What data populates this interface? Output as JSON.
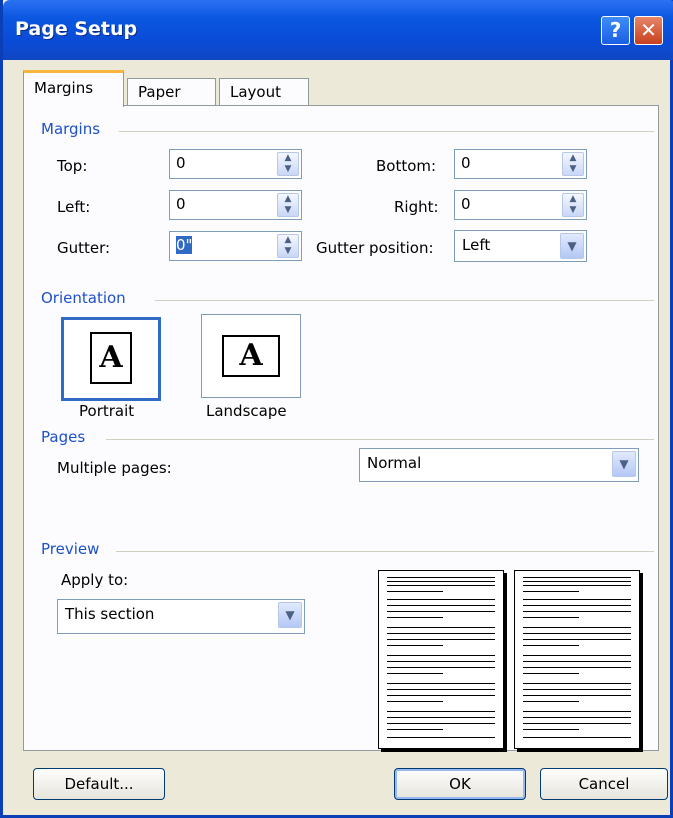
{
  "window": {
    "title": "Page Setup"
  },
  "titlebar": {
    "help_glyph": "?",
    "close_glyph": "✕"
  },
  "tabs": [
    "Margins",
    "Paper",
    "Layout"
  ],
  "margins": {
    "group_label": "Margins",
    "top": {
      "label": "Top:",
      "value": "0"
    },
    "bottom": {
      "label": "Bottom:",
      "value": "0"
    },
    "left": {
      "label": "Left:",
      "value": "0"
    },
    "right": {
      "label": "Right:",
      "value": "0"
    },
    "gutter": {
      "label": "Gutter:",
      "value": "0\""
    },
    "gutter_position": {
      "label": "Gutter position:",
      "value": "Left"
    }
  },
  "orientation": {
    "group_label": "Orientation",
    "portrait": "Portrait",
    "landscape": "Landscape",
    "glyph": "A"
  },
  "pages": {
    "group_label": "Pages",
    "multiple_pages_label": "Multiple pages:",
    "multiple_pages_value": "Normal"
  },
  "preview": {
    "group_label": "Preview",
    "apply_to_label": "Apply to:",
    "apply_to_value": "This section"
  },
  "buttons": {
    "default": "Default...",
    "ok": "OK",
    "cancel": "Cancel"
  },
  "icons": {
    "spinner": "spinner-arrows-icon",
    "dropdown": "chevron-down-icon",
    "help": "help-icon",
    "close": "close-icon"
  },
  "colors": {
    "title_bar": "#0a4bd6",
    "group_label": "#1e50c8",
    "selection": "#316ac5"
  }
}
